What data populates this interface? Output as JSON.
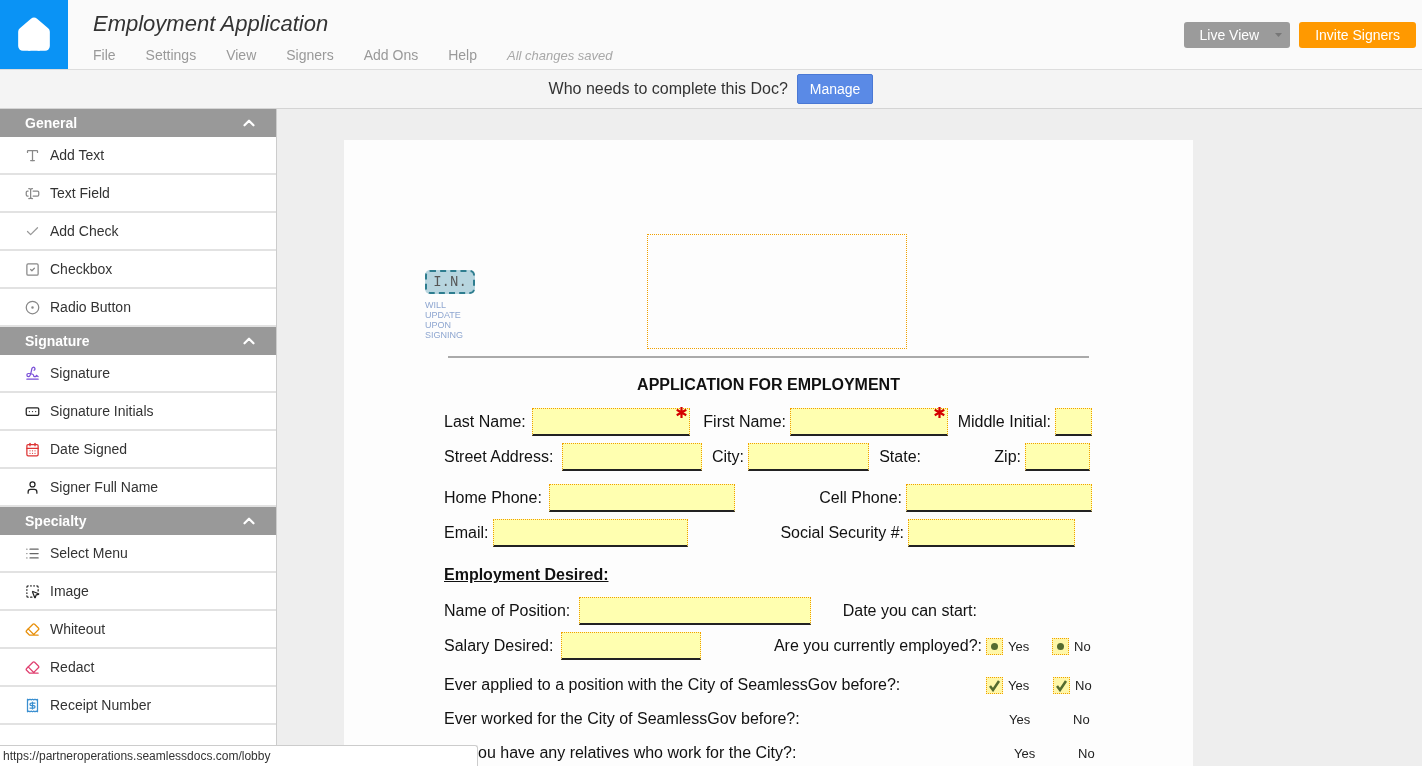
{
  "header": {
    "title": "Employment Application",
    "menu": [
      "File",
      "Settings",
      "View",
      "Signers",
      "Add Ons",
      "Help"
    ],
    "save_status": "All changes saved",
    "buttons": [
      {
        "kind": "split",
        "label": "Live View"
      },
      {
        "kind": "primary",
        "label": "Invite Signers"
      }
    ]
  },
  "banner": {
    "question": "Who needs to complete this Doc?",
    "button": "Manage"
  },
  "sidebar": {
    "sections": [
      {
        "title": "General",
        "expanded": true,
        "items": [
          "Add Text",
          "Text Field",
          "Add Check",
          "Checkbox",
          "Radio Button"
        ]
      },
      {
        "title": "Signature",
        "expanded": true,
        "items": [
          "Signature",
          "Signature Initials",
          "Date Signed",
          "Signer Full Name"
        ]
      },
      {
        "title": "Specialty",
        "expanded": true,
        "items": [
          "Select Menu",
          "Image",
          "Whiteout",
          "Redact",
          "Receipt Number"
        ]
      }
    ]
  },
  "document": {
    "initials": {
      "text": "I.N.",
      "note": "WILL UPDATE UPON SIGNING"
    },
    "heading": "APPLICATION FOR EMPLOYMENT",
    "rows": [
      {
        "items": [
          {
            "kind": "label",
            "text": "Last Name:"
          },
          {
            "kind": "field",
            "required": true
          },
          {
            "kind": "label",
            "text": "First Name:"
          },
          {
            "kind": "field",
            "required": true
          },
          {
            "kind": "label",
            "text": "Middle Initial:"
          },
          {
            "kind": "field",
            "required": false
          }
        ]
      },
      {
        "items": [
          {
            "kind": "label",
            "text": "Street Address:"
          },
          {
            "kind": "field",
            "required": false
          },
          {
            "kind": "label",
            "text": "City:"
          },
          {
            "kind": "field",
            "required": false
          },
          {
            "kind": "label",
            "text": "State:"
          },
          {
            "kind": "label",
            "text": "Zip:"
          },
          {
            "kind": "field",
            "required": false
          }
        ]
      },
      {
        "items": [
          {
            "kind": "label",
            "text": "Home Phone:"
          },
          {
            "kind": "field",
            "required": false
          },
          {
            "kind": "label",
            "text": "Cell Phone:"
          },
          {
            "kind": "field",
            "required": false
          }
        ]
      },
      {
        "items": [
          {
            "kind": "label",
            "text": "Email:"
          },
          {
            "kind": "field",
            "required": false
          },
          {
            "kind": "label",
            "text": "Social Security #:"
          },
          {
            "kind": "field",
            "required": false
          }
        ]
      },
      {
        "items": [
          {
            "kind": "section",
            "text": "Employment Desired:"
          }
        ]
      },
      {
        "items": [
          {
            "kind": "label",
            "text": "Name of Position:"
          },
          {
            "kind": "field",
            "required": false
          },
          {
            "kind": "label",
            "text": "Date you can start:"
          }
        ]
      },
      {
        "items": [
          {
            "kind": "label",
            "text": "Salary Desired:"
          },
          {
            "kind": "field",
            "required": false
          },
          {
            "kind": "label",
            "text": "Are you currently employed?:"
          },
          {
            "kind": "radio",
            "label": "Yes",
            "selected": true
          },
          {
            "kind": "radio",
            "label": "No",
            "selected": true
          }
        ]
      },
      {
        "items": [
          {
            "kind": "label",
            "text": "Ever applied to a position with the City of SeamlessGov before?:"
          },
          {
            "kind": "check",
            "label": "Yes",
            "checked": true
          },
          {
            "kind": "check",
            "label": "No",
            "checked": true
          }
        ]
      },
      {
        "items": [
          {
            "kind": "label",
            "text": "Ever worked for the City of SeamlessGov before?:"
          },
          {
            "kind": "plain",
            "label": "Yes"
          },
          {
            "kind": "plain",
            "label": "No"
          }
        ]
      },
      {
        "items": [
          {
            "kind": "label",
            "text": "ou have any relatives who work for the City?:"
          },
          {
            "kind": "plain",
            "label": "Yes"
          },
          {
            "kind": "plain",
            "label": "No"
          }
        ]
      }
    ]
  },
  "status_url": "https://partneroperations.seamlessdocs.com/lobby"
}
